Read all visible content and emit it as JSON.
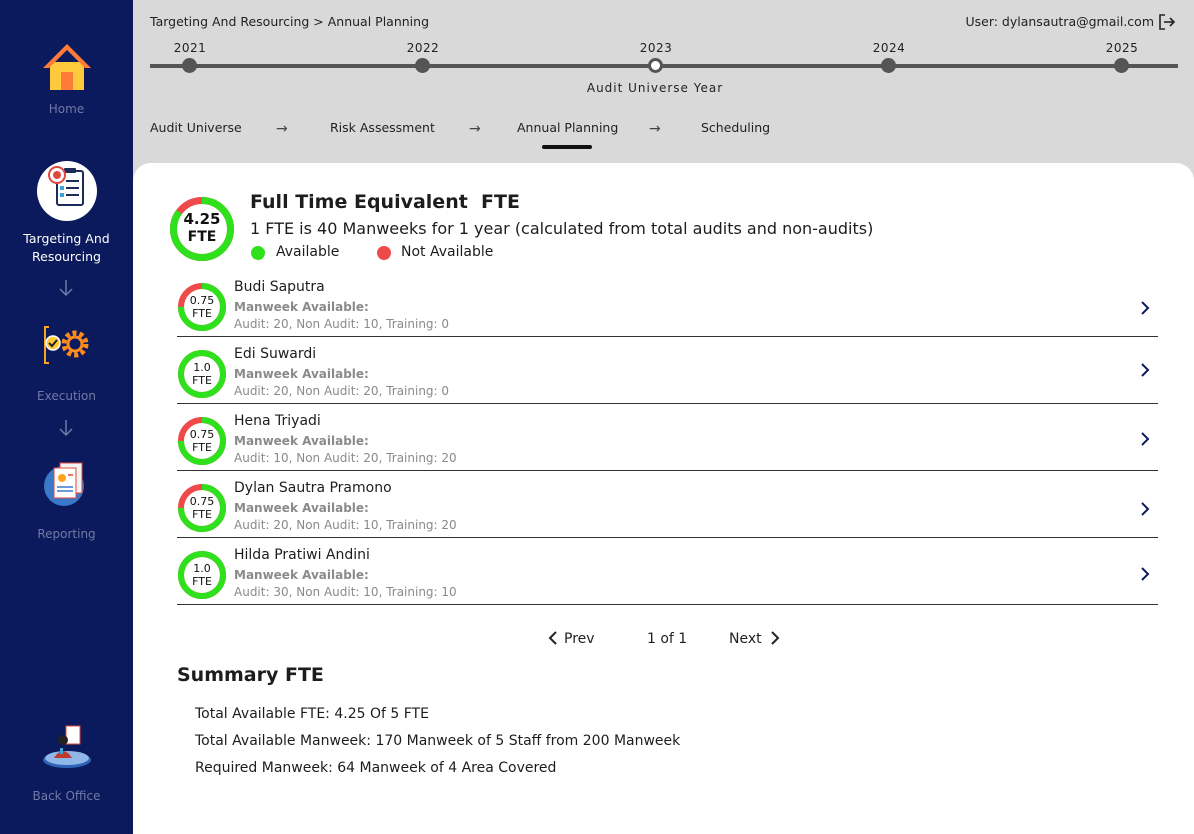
{
  "sidebar": {
    "items": [
      {
        "label": "Home",
        "icon": "home-icon"
      },
      {
        "label": "Targeting And Resourcing",
        "icon": "target-checklist-icon"
      },
      {
        "label": "Execution",
        "icon": "execution-gear-icon"
      },
      {
        "label": "Reporting",
        "icon": "report-document-icon"
      },
      {
        "label": "Back Office",
        "icon": "back-office-icon"
      }
    ]
  },
  "header": {
    "breadcrumb": "Targeting And Resourcing > Annual Planning",
    "user": "User: dylansautra@gmail.com"
  },
  "timeline": {
    "years": [
      "2021",
      "2022",
      "2023",
      "2024",
      "2025"
    ],
    "selected": "2023",
    "caption": "Audit Universe Year"
  },
  "steps": [
    "Audit Universe",
    "Risk Assessment",
    "Annual Planning",
    "Scheduling"
  ],
  "fte": {
    "total": "4.25",
    "unit": "FTE",
    "available_fraction": 0.85,
    "title": "Full Time Equivalent  FTE",
    "subtitle": "1 FTE is 40 Manweeks for 1 year (calculated from total audits and non-audits)",
    "legend_available": "Available",
    "legend_not_available": "Not Available"
  },
  "colors": {
    "available": "#2fe01c",
    "not_available": "#ef4a4a",
    "sidebar": "#0b1a5c"
  },
  "staff": [
    {
      "name": "Budi Saputra",
      "fte": "0.75",
      "fraction": 0.75,
      "label": "Manweek Available:",
      "detail": "Audit: 20, Non Audit: 10, Training: 0"
    },
    {
      "name": "Edi Suwardi",
      "fte": "1.0",
      "fraction": 1.0,
      "label": "Manweek Available:",
      "detail": "Audit: 20, Non Audit: 20, Training: 0"
    },
    {
      "name": "Hena Triyadi",
      "fte": "0.75",
      "fraction": 0.75,
      "label": "Manweek Available:",
      "detail": "Audit: 10, Non Audit: 20, Training: 20"
    },
    {
      "name": "Dylan Sautra Pramono",
      "fte": "0.75",
      "fraction": 0.75,
      "label": "Manweek Available:",
      "detail": "Audit: 20, Non Audit: 10, Training: 20"
    },
    {
      "name": "Hilda Pratiwi Andini",
      "fte": "1.0",
      "fraction": 1.0,
      "label": "Manweek Available:",
      "detail": "Audit: 30, Non Audit: 10, Training: 10"
    }
  ],
  "pagination": {
    "prev": "Prev",
    "page": "1 of 1",
    "next": "Next"
  },
  "summary": {
    "title": "Summary FTE",
    "lines": [
      "Total Available FTE:  4.25 Of 5 FTE",
      "Total Available Manweek:  170 Manweek of 5 Staff from 200 Manweek",
      "Required Manweek: 64 Manweek of 4 Area Covered"
    ]
  }
}
